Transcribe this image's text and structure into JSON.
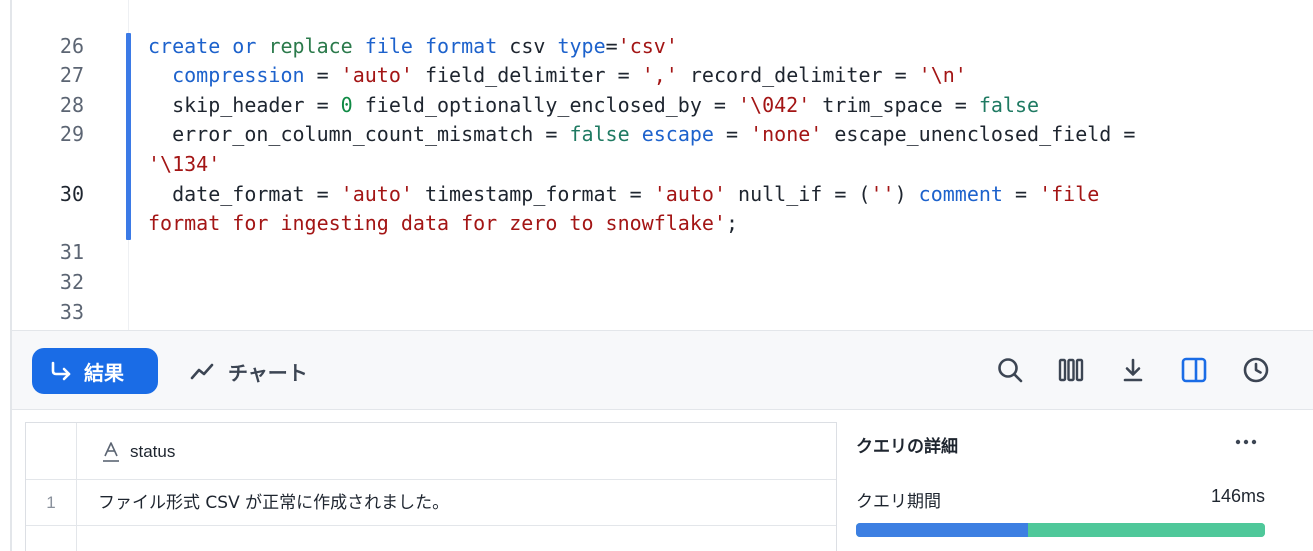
{
  "editor": {
    "lines": [
      {
        "number": "26",
        "active": false,
        "segments": [
          {
            "t": "create",
            "c": "kw"
          },
          {
            "t": " ",
            "c": ""
          },
          {
            "t": "or",
            "c": "kw"
          },
          {
            "t": " ",
            "c": ""
          },
          {
            "t": "replace",
            "c": "fn"
          },
          {
            "t": " ",
            "c": ""
          },
          {
            "t": "file",
            "c": "kw"
          },
          {
            "t": " ",
            "c": ""
          },
          {
            "t": "format",
            "c": "kw"
          },
          {
            "t": " csv ",
            "c": ""
          },
          {
            "t": "type",
            "c": "kw"
          },
          {
            "t": "=",
            "c": ""
          },
          {
            "t": "'csv'",
            "c": "str"
          }
        ]
      },
      {
        "number": "27",
        "active": false,
        "segments": [
          {
            "t": "  ",
            "c": ""
          },
          {
            "t": "compression",
            "c": "kw"
          },
          {
            "t": " = ",
            "c": ""
          },
          {
            "t": "'auto'",
            "c": "str"
          },
          {
            "t": " field_delimiter = ",
            "c": ""
          },
          {
            "t": "','",
            "c": "str"
          },
          {
            "t": " record_delimiter = ",
            "c": ""
          },
          {
            "t": "'\\n'",
            "c": "str"
          }
        ]
      },
      {
        "number": "28",
        "active": false,
        "segments": [
          {
            "t": "  skip_header = ",
            "c": ""
          },
          {
            "t": "0",
            "c": "num"
          },
          {
            "t": " field_optionally_enclosed_by = ",
            "c": ""
          },
          {
            "t": "'\\042'",
            "c": "str"
          },
          {
            "t": " trim_space = ",
            "c": ""
          },
          {
            "t": "false",
            "c": "bool"
          }
        ]
      },
      {
        "number": "29",
        "active": false,
        "segments": [
          {
            "t": "  error_on_column_count_mismatch = ",
            "c": ""
          },
          {
            "t": "false",
            "c": "bool"
          },
          {
            "t": " ",
            "c": ""
          },
          {
            "t": "escape",
            "c": "kw"
          },
          {
            "t": " = ",
            "c": ""
          },
          {
            "t": "'none'",
            "c": "str"
          },
          {
            "t": " escape_unenclosed_field =",
            "c": ""
          }
        ]
      },
      {
        "number": "",
        "active": false,
        "segments": [
          {
            "t": "'\\134'",
            "c": "str"
          }
        ]
      },
      {
        "number": "30",
        "active": true,
        "segments": [
          {
            "t": "  date_format = ",
            "c": ""
          },
          {
            "t": "'auto'",
            "c": "str"
          },
          {
            "t": " timestamp_format = ",
            "c": ""
          },
          {
            "t": "'auto'",
            "c": "str"
          },
          {
            "t": " null_if = (",
            "c": ""
          },
          {
            "t": "''",
            "c": "str"
          },
          {
            "t": ") ",
            "c": ""
          },
          {
            "t": "comment",
            "c": "kw"
          },
          {
            "t": " = ",
            "c": ""
          },
          {
            "t": "'file",
            "c": "str"
          }
        ]
      },
      {
        "number": "",
        "active": false,
        "segments": [
          {
            "t": "format for ingesting data for zero to snowflake'",
            "c": "str"
          },
          {
            "t": ";",
            "c": ""
          }
        ]
      },
      {
        "number": "31",
        "active": false,
        "segments": []
      },
      {
        "number": "32",
        "active": false,
        "segments": []
      },
      {
        "number": "33",
        "active": false,
        "segments": []
      }
    ]
  },
  "toolbar": {
    "results_label": "結果",
    "chart_label": "チャート",
    "icons": [
      "search-icon",
      "columns-icon",
      "download-icon",
      "split-panel-icon",
      "history-icon"
    ]
  },
  "results": {
    "column_header": "status",
    "column_type_icon": "text-type-icon",
    "rows": [
      {
        "num": "1",
        "status": "ファイル形式 CSV が正常に作成されました。"
      }
    ]
  },
  "details": {
    "title": "クエリの詳細",
    "duration_label": "クエリ期間",
    "duration_value": "146ms",
    "duration_split": {
      "compile_fraction": 0.42,
      "execution_fraction": 0.58
    },
    "colors": {
      "compile": "#3d7fe2",
      "execution": "#4fc89a"
    }
  },
  "colors": {
    "accent": "#1a6ce6",
    "keyword": "#1d62cc",
    "string": "#a31515",
    "number": "#0f8a44",
    "boolean": "#1f7a62"
  }
}
